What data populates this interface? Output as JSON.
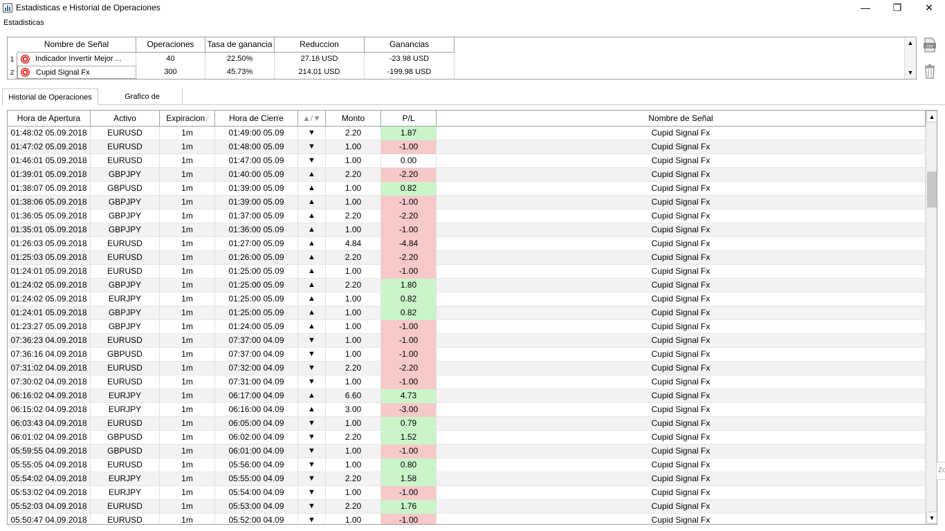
{
  "window": {
    "title": "Estadisticas e Historial de Operaciones",
    "min_glyph": "—",
    "max_glyph": "❐",
    "close_glyph": "✕"
  },
  "stats": {
    "section_label": "Estadisticas",
    "headers": [
      "Nombre de Señal",
      "Operaciones",
      "Tasa de ganancia",
      "Reduccion",
      "Ganancias"
    ],
    "rows": [
      {
        "num": "1",
        "name": "Indicador Invertir Mejor ...",
        "ops": "40",
        "rate": "22.50%",
        "reduction": "27.16 USD",
        "gains": "-23.98 USD"
      },
      {
        "num": "2",
        "name": "Cupid Signal Fx",
        "ops": "300",
        "rate": "45.73%",
        "reduction": "214.01 USD",
        "gains": "-199.98 USD"
      }
    ],
    "side_buttons": [
      "csv-export-icon",
      "trash-icon"
    ]
  },
  "tabs": [
    {
      "label": "Historial de Operaciones",
      "active": true
    },
    {
      "label": "Grafico de Ganacias",
      "active": false
    }
  ],
  "history": {
    "headers": [
      "Hora de Apertura",
      "Activo",
      "Expiracion",
      "Hora de Cierre",
      "▲/▼",
      "Monto",
      "P/L",
      "Nombre de Señal"
    ],
    "rows": [
      {
        "open": "01:48:02 05.09.2018",
        "asset": "EURUSD",
        "exp": "1m",
        "close": "01:49:00 05.09",
        "dir": "▼",
        "amount": "2.20",
        "pl": "1.87",
        "plc": "pos",
        "signal": "Cupid Signal Fx"
      },
      {
        "open": "01:47:02 05.09.2018",
        "asset": "EURUSD",
        "exp": "1m",
        "close": "01:48:00 05.09",
        "dir": "▼",
        "amount": "1.00",
        "pl": "-1.00",
        "plc": "neg",
        "signal": "Cupid Signal Fx"
      },
      {
        "open": "01:46:01 05.09.2018",
        "asset": "EURUSD",
        "exp": "1m",
        "close": "01:47:00 05.09",
        "dir": "▼",
        "amount": "1.00",
        "pl": "0.00",
        "plc": "zero",
        "signal": "Cupid Signal Fx"
      },
      {
        "open": "01:39:01 05.09.2018",
        "asset": "GBPJPY",
        "exp": "1m",
        "close": "01:40:00 05.09",
        "dir": "▲",
        "amount": "2.20",
        "pl": "-2.20",
        "plc": "neg",
        "signal": "Cupid Signal Fx"
      },
      {
        "open": "01:38:07 05.09.2018",
        "asset": "GBPUSD",
        "exp": "1m",
        "close": "01:39:00 05.09",
        "dir": "▲",
        "amount": "1.00",
        "pl": "0.82",
        "plc": "pos",
        "signal": "Cupid Signal Fx"
      },
      {
        "open": "01:38:06 05.09.2018",
        "asset": "GBPJPY",
        "exp": "1m",
        "close": "01:39:00 05.09",
        "dir": "▲",
        "amount": "1.00",
        "pl": "-1.00",
        "plc": "neg",
        "signal": "Cupid Signal Fx"
      },
      {
        "open": "01:36:05 05.09.2018",
        "asset": "GBPJPY",
        "exp": "1m",
        "close": "01:37:00 05.09",
        "dir": "▲",
        "amount": "2.20",
        "pl": "-2.20",
        "plc": "neg",
        "signal": "Cupid Signal Fx"
      },
      {
        "open": "01:35:01 05.09.2018",
        "asset": "GBPJPY",
        "exp": "1m",
        "close": "01:36:00 05.09",
        "dir": "▲",
        "amount": "1.00",
        "pl": "-1.00",
        "plc": "neg",
        "signal": "Cupid Signal Fx"
      },
      {
        "open": "01:26:03 05.09.2018",
        "asset": "EURUSD",
        "exp": "1m",
        "close": "01:27:00 05.09",
        "dir": "▲",
        "amount": "4.84",
        "pl": "-4.84",
        "plc": "neg",
        "signal": "Cupid Signal Fx"
      },
      {
        "open": "01:25:03 05.09.2018",
        "asset": "EURUSD",
        "exp": "1m",
        "close": "01:26:00 05.09",
        "dir": "▲",
        "amount": "2.20",
        "pl": "-2.20",
        "plc": "neg",
        "signal": "Cupid Signal Fx"
      },
      {
        "open": "01:24:01 05.09.2018",
        "asset": "EURUSD",
        "exp": "1m",
        "close": "01:25:00 05.09",
        "dir": "▲",
        "amount": "1.00",
        "pl": "-1.00",
        "plc": "neg",
        "signal": "Cupid Signal Fx"
      },
      {
        "open": "01:24:02 05.09.2018",
        "asset": "GBPJPY",
        "exp": "1m",
        "close": "01:25:00 05.09",
        "dir": "▲",
        "amount": "2.20",
        "pl": "1.80",
        "plc": "pos",
        "signal": "Cupid Signal Fx"
      },
      {
        "open": "01:24:02 05.09.2018",
        "asset": "EURJPY",
        "exp": "1m",
        "close": "01:25:00 05.09",
        "dir": "▲",
        "amount": "1.00",
        "pl": "0.82",
        "plc": "pos",
        "signal": "Cupid Signal Fx"
      },
      {
        "open": "01:24:01 05.09.2018",
        "asset": "GBPJPY",
        "exp": "1m",
        "close": "01:25:00 05.09",
        "dir": "▲",
        "amount": "1.00",
        "pl": "0.82",
        "plc": "pos",
        "signal": "Cupid Signal Fx"
      },
      {
        "open": "01:23:27 05.09.2018",
        "asset": "GBPJPY",
        "exp": "1m",
        "close": "01:24:00 05.09",
        "dir": "▲",
        "amount": "1.00",
        "pl": "-1.00",
        "plc": "neg",
        "signal": "Cupid Signal Fx"
      },
      {
        "open": "07:36:23 04.09.2018",
        "asset": "EURUSD",
        "exp": "1m",
        "close": "07:37:00 04.09",
        "dir": "▼",
        "amount": "1.00",
        "pl": "-1.00",
        "plc": "neg",
        "signal": "Cupid Signal Fx"
      },
      {
        "open": "07:36:16 04.09.2018",
        "asset": "GBPUSD",
        "exp": "1m",
        "close": "07:37:00 04.09",
        "dir": "▼",
        "amount": "1.00",
        "pl": "-1.00",
        "plc": "neg",
        "signal": "Cupid Signal Fx"
      },
      {
        "open": "07:31:02 04.09.2018",
        "asset": "EURUSD",
        "exp": "1m",
        "close": "07:32:00 04.09",
        "dir": "▼",
        "amount": "2.20",
        "pl": "-2.20",
        "plc": "neg",
        "signal": "Cupid Signal Fx"
      },
      {
        "open": "07:30:02 04.09.2018",
        "asset": "EURUSD",
        "exp": "1m",
        "close": "07:31:00 04.09",
        "dir": "▼",
        "amount": "1.00",
        "pl": "-1.00",
        "plc": "neg",
        "signal": "Cupid Signal Fx"
      },
      {
        "open": "06:16:02 04.09.2018",
        "asset": "EURJPY",
        "exp": "1m",
        "close": "06:17:00 04.09",
        "dir": "▲",
        "amount": "6.60",
        "pl": "4.73",
        "plc": "pos",
        "signal": "Cupid Signal Fx"
      },
      {
        "open": "06:15:02 04.09.2018",
        "asset": "EURJPY",
        "exp": "1m",
        "close": "06:16:00 04.09",
        "dir": "▲",
        "amount": "3.00",
        "pl": "-3.00",
        "plc": "neg",
        "signal": "Cupid Signal Fx"
      },
      {
        "open": "06:03:43 04.09.2018",
        "asset": "EURUSD",
        "exp": "1m",
        "close": "06:05:00 04.09",
        "dir": "▼",
        "amount": "1.00",
        "pl": "0.79",
        "plc": "pos",
        "signal": "Cupid Signal Fx"
      },
      {
        "open": "06:01:02 04.09.2018",
        "asset": "GBPUSD",
        "exp": "1m",
        "close": "06:02:00 04.09",
        "dir": "▼",
        "amount": "2.20",
        "pl": "1.52",
        "plc": "pos",
        "signal": "Cupid Signal Fx"
      },
      {
        "open": "05:59:55 04.09.2018",
        "asset": "GBPUSD",
        "exp": "1m",
        "close": "06:01:00 04.09",
        "dir": "▼",
        "amount": "1.00",
        "pl": "-1.00",
        "plc": "neg",
        "signal": "Cupid Signal Fx"
      },
      {
        "open": "05:55:05 04.09.2018",
        "asset": "EURUSD",
        "exp": "1m",
        "close": "05:56:00 04.09",
        "dir": "▼",
        "amount": "1.00",
        "pl": "0.80",
        "plc": "pos",
        "signal": "Cupid Signal Fx"
      },
      {
        "open": "05:54:02 04.09.2018",
        "asset": "EURJPY",
        "exp": "1m",
        "close": "05:55:00 04.09",
        "dir": "▼",
        "amount": "2.20",
        "pl": "1.58",
        "plc": "pos",
        "signal": "Cupid Signal Fx"
      },
      {
        "open": "05:53:02 04.09.2018",
        "asset": "EURJPY",
        "exp": "1m",
        "close": "05:54:00 04.09",
        "dir": "▼",
        "amount": "1.00",
        "pl": "-1.00",
        "plc": "neg",
        "signal": "Cupid Signal Fx"
      },
      {
        "open": "05:52:03 04.09.2018",
        "asset": "EURUSD",
        "exp": "1m",
        "close": "05:53:00 04.09",
        "dir": "▼",
        "amount": "2.20",
        "pl": "1.76",
        "plc": "pos",
        "signal": "Cupid Signal Fx"
      },
      {
        "open": "05:50:47 04.09.2018",
        "asset": "EURUSD",
        "exp": "1m",
        "close": "05:52:00 04.09",
        "dir": "▼",
        "amount": "1.00",
        "pl": "-1.00",
        "plc": "neg",
        "signal": "Cupid Signal Fx"
      }
    ]
  },
  "edge_tab": {
    "label": "Zo"
  },
  "colors": {
    "positive": "#c9f5c9",
    "negative": "#f7c9c9"
  }
}
